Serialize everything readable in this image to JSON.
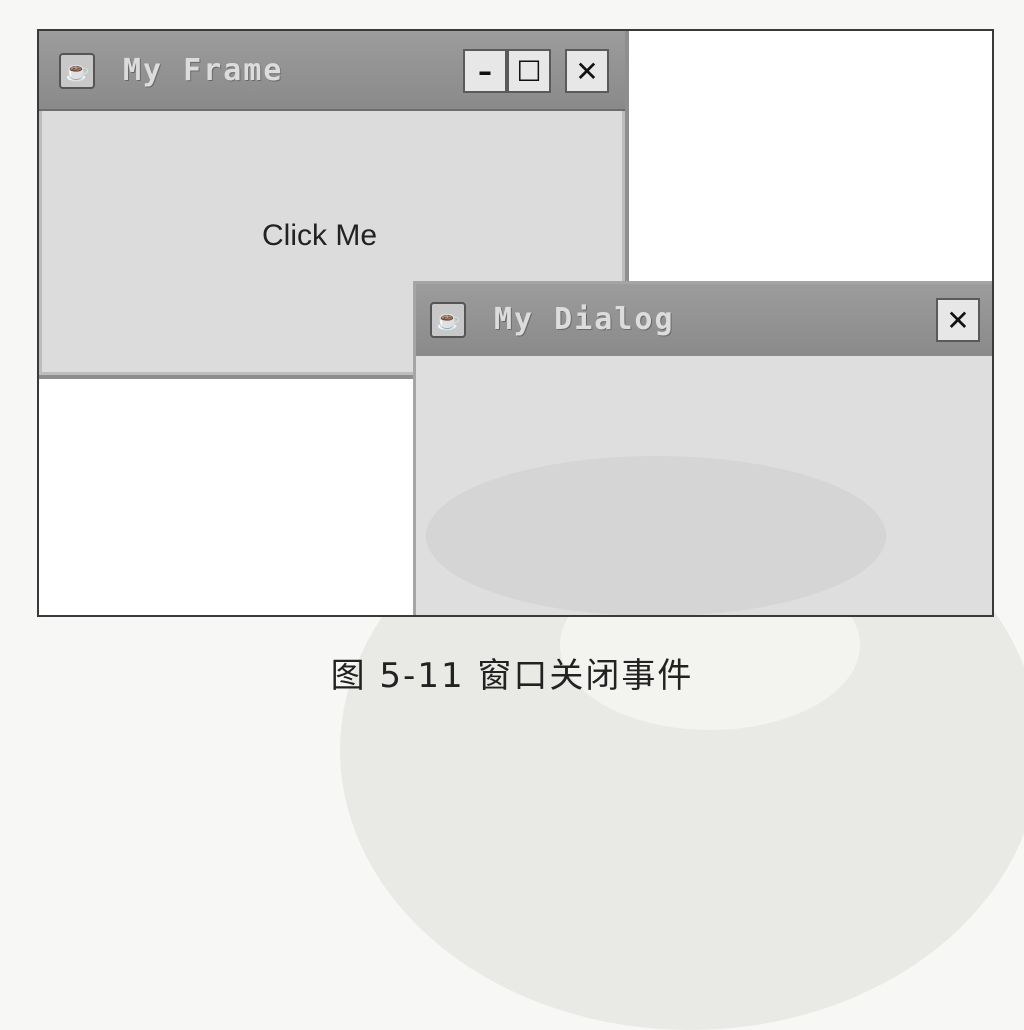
{
  "frame": {
    "title": "My Frame",
    "button_label": "Click Me",
    "controls": {
      "minimize_glyph": "–",
      "maximize_glyph": "☐",
      "close_glyph": "✕"
    },
    "app_icon": "java-cup-icon"
  },
  "dialog": {
    "title": "My Dialog",
    "controls": {
      "close_glyph": "✕"
    },
    "app_icon": "java-cup-icon"
  },
  "caption": "图 5-11   窗口关闭事件"
}
